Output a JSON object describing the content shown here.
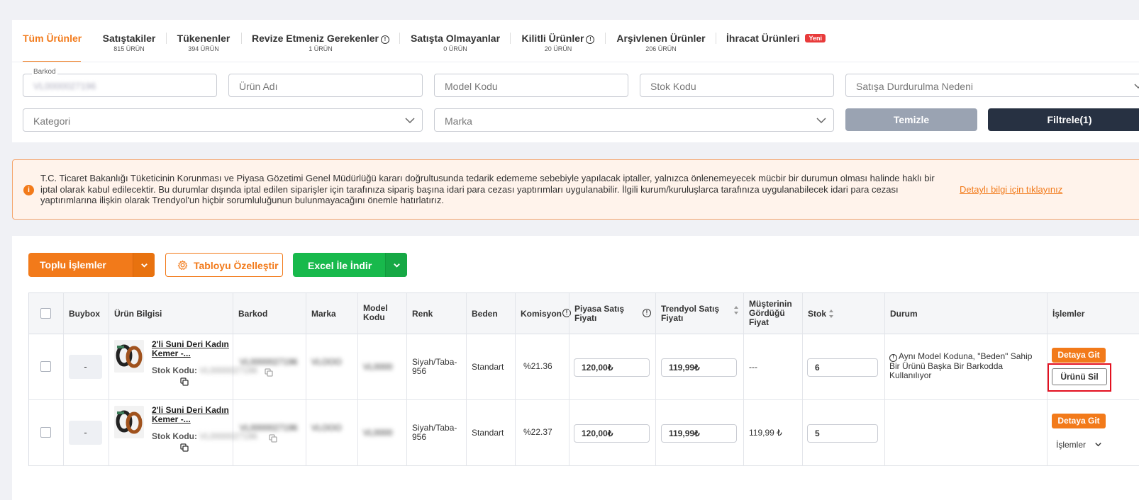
{
  "tabs": [
    {
      "label": "Tüm Ürünler",
      "count": ""
    },
    {
      "label": "Satıştakiler",
      "count": "815 ÜRÜN"
    },
    {
      "label": "Tükenenler",
      "count": "394 ÜRÜN"
    },
    {
      "label": "Revize Etmeniz Gerekenler",
      "count": "1 ÜRÜN"
    },
    {
      "label": "Satışta Olmayanlar",
      "count": "0 ÜRÜN"
    },
    {
      "label": "Kilitli Ürünler",
      "count": "20 ÜRÜN"
    },
    {
      "label": "Arşivlenen Ürünler",
      "count": "206 ÜRÜN"
    },
    {
      "label": "İhracat Ürünleri",
      "count": ""
    }
  ],
  "new_badge": "Yeni",
  "filters": {
    "barcode_label": "Barkod",
    "barcode_value": "VL0000027196",
    "product_name": "Ürün Adı",
    "model_code": "Model Kodu",
    "stock_code": "Stok Kodu",
    "stop_reason": "Satışa Durdurulma Nedeni",
    "category": "Kategori",
    "brand": "Marka",
    "clear": "Temizle",
    "filter": "Filtrele(1)"
  },
  "warning": {
    "text": "T.C. Ticaret Bakanlığı Tüketicinin Korunması ve Piyasa Gözetimi Genel Müdürlüğü kararı doğrultusunda tedarik edememe sebebiyle yapılacak iptaller, yalnızca önlenemeyecek mücbir bir durumun olması halinde haklı bir iptal olarak kabul edilecektir. Bu durumlar dışında iptal edilen siparişler için tarafınıza sipariş başına idari para cezası yaptırımları uygulanabilir. İlgili kurum/kuruluşlarca tarafınıza uygulanabilecek idari para cezası yaptırımlarına ilişkin olarak Trendyol'un hiçbir sorumluluğunun bulunmayacağını önemle hatırlatırız.",
    "link": "Detaylı bilgi için tıklayınız"
  },
  "toolbar": {
    "bulk": "Toplu İşlemler",
    "customize": "Tabloyu Özelleştir",
    "excel": "Excel İle İndir"
  },
  "columns": {
    "buybox": "Buybox",
    "product_info": "Ürün Bilgisi",
    "barcode": "Barkod",
    "brand": "Marka",
    "model_code": "Model Kodu",
    "color": "Renk",
    "size": "Beden",
    "commission": "Komisyon",
    "market_price": "Piyasa Satış Fiyatı",
    "trendyol_price": "Trendyol Satış Fiyatı",
    "customer_price": "Müşterinin Gördüğü Fiyat",
    "stock": "Stok",
    "status": "Durum",
    "actions": "İşlemler"
  },
  "rows": [
    {
      "buybox": "-",
      "name": "2'li Suni Deri Kadın Kemer -...",
      "stock_code_label": "Stok Kodu:",
      "stock_code": "VL0000027196",
      "barcode": "VL0000027196",
      "brand": "VLOOO",
      "model": "VL0000",
      "color": "Siyah/Taba-956",
      "size": "Standart",
      "commission": "%21.36",
      "market_price": "120,00₺",
      "trendyol_price": "119,99₺",
      "customer_price": "---",
      "stock": "6",
      "status": "Aynı Model Koduna, \"Beden\" Sahip Bir Ürünü Başka Bir Barkodda Kullanılıyor",
      "detail": "Detaya Git",
      "delete": "Ürünü Sil"
    },
    {
      "buybox": "-",
      "name": "2'li Suni Deri Kadın Kemer -...",
      "stock_code_label": "Stok Kodu:",
      "stock_code": "VL0000027196",
      "barcode": "VL0000027196",
      "brand": "VLOOO",
      "model": "VL0000",
      "color": "Siyah/Taba-956",
      "size": "Standart",
      "commission": "%22.37",
      "market_price": "120,00₺",
      "trendyol_price": "119,99₺",
      "customer_price": "119,99 ₺",
      "stock": "5",
      "status": "",
      "detail": "Detaya Git",
      "operations": "İşlemler"
    }
  ],
  "colors": {
    "accent": "#f27a1a",
    "dark": "#273142",
    "green": "#18b94c",
    "highlight": "#e3101f"
  }
}
